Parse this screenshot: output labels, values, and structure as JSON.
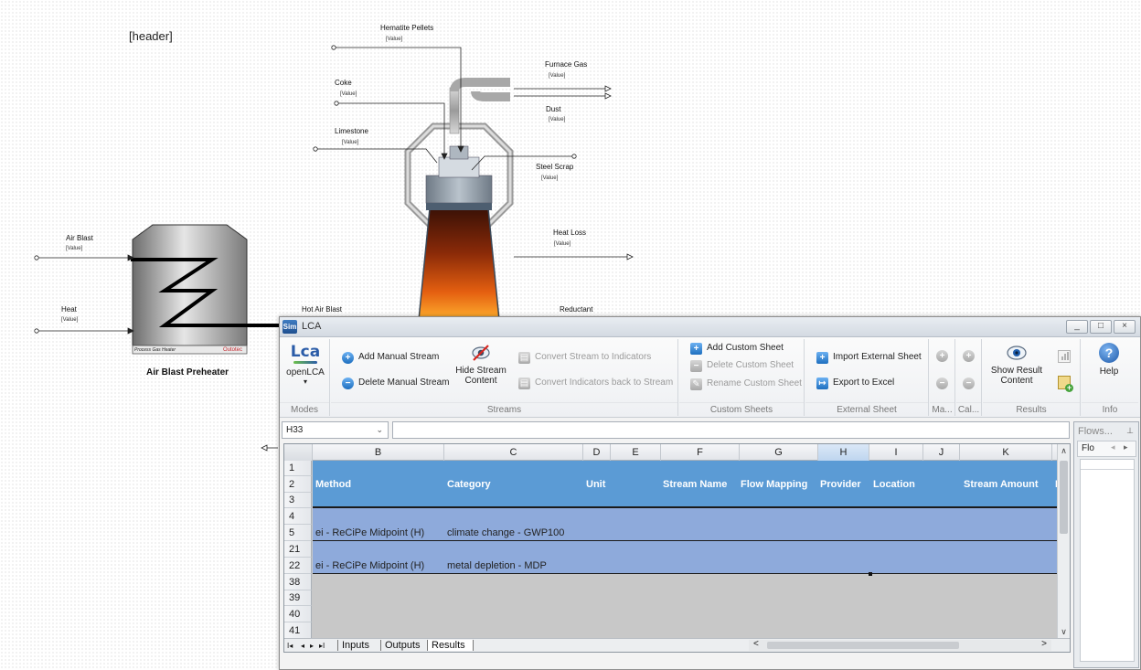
{
  "flowsheet": {
    "header_placeholder": "[header]",
    "value_placeholder": "[Value]",
    "furnace_streams": {
      "hematite_pellets": "Hematite Pellets",
      "coke": "Coke",
      "limestone": "Limestone",
      "furnace_gas": "Furnace Gas",
      "dust": "Dust",
      "steel_scrap": "Steel Scrap",
      "heat_loss": "Heat Loss",
      "hot_air_blast": "Hot Air Blast",
      "reductant": "Reductant"
    },
    "preheater_streams": {
      "air_blast": "Air Blast",
      "heat": "Heat"
    },
    "preheater_plate": "Process Gas Heater",
    "preheater_brand": "Outotec",
    "preheater_caption": "Air Blast Preheater"
  },
  "window": {
    "app_icon": "Sim",
    "title": "LCA",
    "controls": {
      "minimize": "_",
      "maximize": "□",
      "close": "×"
    }
  },
  "ribbon": {
    "modes": {
      "lca_logo": "Lca",
      "openlca": "openLCA",
      "dropdown": "▾",
      "label": "Modes"
    },
    "streams": {
      "add_manual": "Add Manual Stream",
      "delete_manual": "Delete Manual Stream",
      "hide_line1": "Hide Stream",
      "hide_line2": "Content",
      "convert_to_indicators": "Convert Stream to Indicators",
      "convert_back": "Convert Indicators back to Stream",
      "label": "Streams"
    },
    "custom_sheets": {
      "add": "Add Custom Sheet",
      "delete": "Delete Custom Sheet",
      "rename": "Rename Custom Sheet",
      "label": "Custom Sheets"
    },
    "external_sheet": {
      "import": "Import External Sheet",
      "export": "Export to Excel",
      "label": "External Sheet"
    },
    "ma_label": "Ma...",
    "cal_label": "Cal...",
    "results": {
      "show_line1": "Show Result",
      "show_line2": "Content",
      "label": "Results"
    },
    "info": {
      "help": "Help",
      "label": "Info",
      "help_icon": "?"
    }
  },
  "spreadsheet": {
    "name_box": "H33",
    "formula": "",
    "columns": [
      "B",
      "C",
      "D",
      "E",
      "F",
      "G",
      "H",
      "I",
      "J",
      "K"
    ],
    "header_row": {
      "method": "Method",
      "category": "Category",
      "unit": "Unit",
      "stream_name": "Stream Name",
      "flow_mapping": "Flow Mapping",
      "provider": "Provider",
      "location": "Location",
      "stream_amount": "Stream Amount",
      "overflow": "N"
    },
    "rows": [
      "1",
      "2",
      "3",
      "4",
      "5",
      "21",
      "22",
      "38",
      "39",
      "40",
      "41"
    ],
    "row5": {
      "method": "ei -  ReCiPe Midpoint (H)",
      "category": "climate change - GWP100"
    },
    "row22": {
      "method": "ei -  ReCiPe Midpoint (H)",
      "category": "metal depletion - MDP"
    },
    "nav": {
      "first": "I◂",
      "prev": "◂",
      "next": "▸",
      "last": "▸I"
    },
    "tabs": [
      "Inputs",
      "Outputs",
      "Results"
    ]
  },
  "side_panel": {
    "title": "Flows...",
    "pin": "⊥",
    "tab": "Flo"
  },
  "colors": {
    "header_band": "#5b9bd5",
    "data_band": "#8eaadb",
    "empty_area": "#c8c8c8",
    "selected_column": "#bed5ef"
  }
}
